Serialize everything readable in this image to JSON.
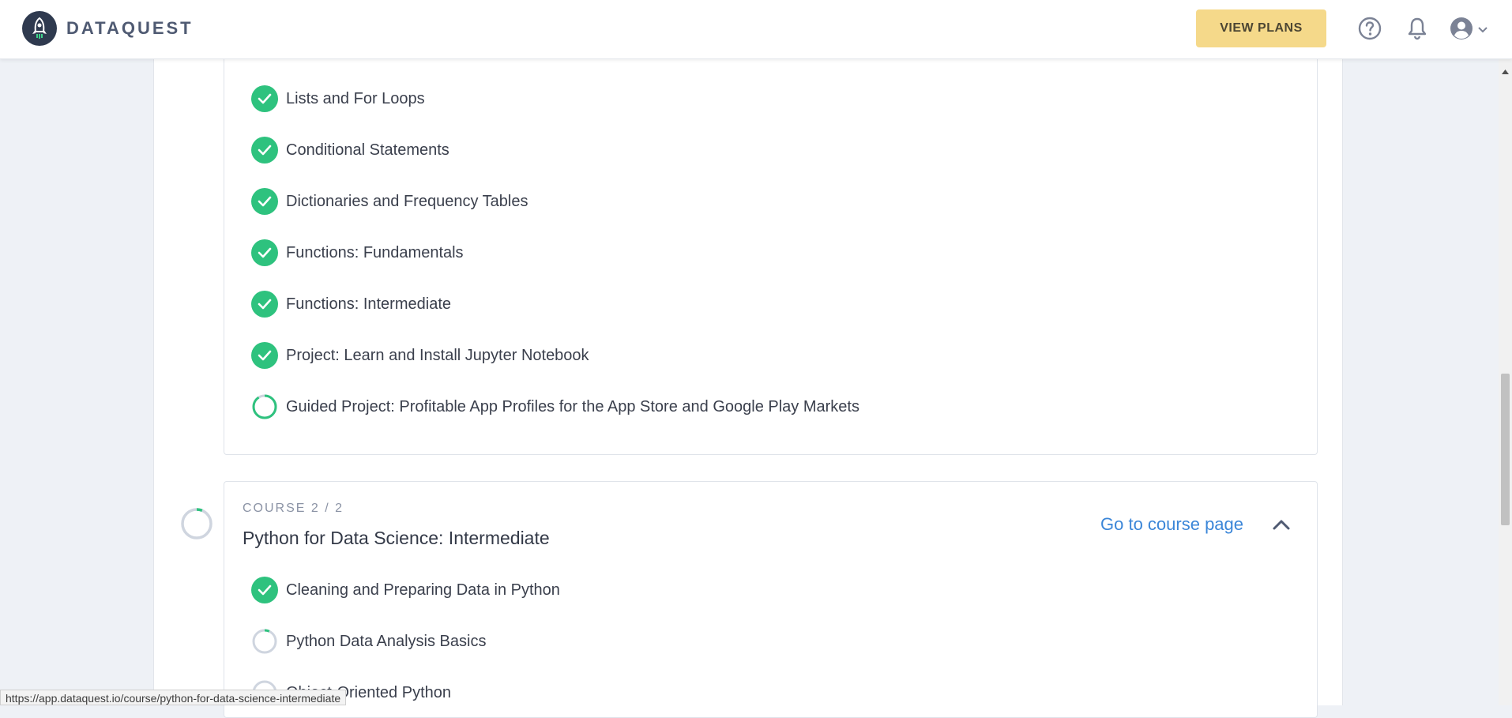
{
  "header": {
    "brand": "DATAQUEST",
    "view_plans_label": "VIEW PLANS",
    "icons": [
      "help-icon",
      "bell-icon",
      "user-avatar-icon",
      "chevron-down-icon"
    ]
  },
  "course1": {
    "lessons": [
      {
        "label": "Lists and For Loops",
        "status": "complete"
      },
      {
        "label": "Conditional Statements",
        "status": "complete"
      },
      {
        "label": "Dictionaries and Frequency Tables",
        "status": "complete"
      },
      {
        "label": "Functions: Fundamentals",
        "status": "complete"
      },
      {
        "label": "Functions: Intermediate",
        "status": "complete"
      },
      {
        "label": "Project: Learn and Install Jupyter Notebook",
        "status": "complete"
      },
      {
        "label": "Guided Project: Profitable App Profiles for the App Store and Google Play Markets",
        "status": "in-progress"
      }
    ]
  },
  "course2": {
    "kicker": "COURSE 2 / 2",
    "title": "Python for Data Science: Intermediate",
    "link_label": "Go to course page",
    "lessons": [
      {
        "label": "Cleaning and Preparing Data in Python",
        "status": "complete"
      },
      {
        "label": "Python Data Analysis Basics",
        "status": "in-progress"
      },
      {
        "label": "Object-Oriented Python",
        "status": "not-started"
      }
    ]
  },
  "colors": {
    "accent_green": "#2ec27e",
    "link_blue": "#3b86d8",
    "plans_yellow": "#f5d98a"
  },
  "status_bar": {
    "url": "https://app.dataquest.io/course/python-for-data-science-intermediate"
  }
}
